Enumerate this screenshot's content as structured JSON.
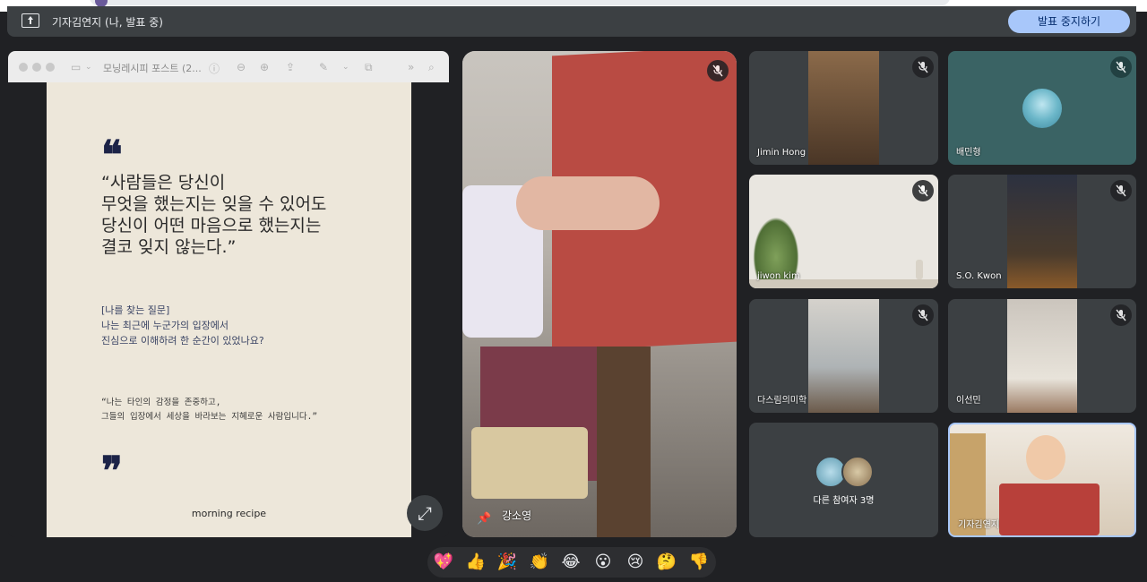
{
  "banner": {
    "presenting_label": "기자김연지 (나, 발표 중)",
    "stop_button": "발표 중지하기"
  },
  "presentation": {
    "viewer_title": "모닝레시피 포스트 (2...",
    "quote_lines": [
      "“사람들은 당신이",
      "무엇을 했는지는 잊을 수 있어도",
      "당신이 어떤 마음으로 했는지는",
      "결코 잊지 않는다.”"
    ],
    "question_lines": [
      "[나를 찾는 질문]",
      "나는 최근에 누군가의 입장에서",
      "진심으로 이해하려 한 순간이 있었나요?"
    ],
    "answer_lines": [
      "“나는 타인의 감정을 존중하고,",
      " 그들의 입장에서 세상을 바라보는 지혜로운 사람입니다.”"
    ],
    "brand": "morning recipe",
    "open_quote": "❝",
    "close_quote": "❞"
  },
  "pinned": {
    "name": "강소영"
  },
  "participants": [
    {
      "name": "Jimin Hong"
    },
    {
      "name": "배민형"
    },
    {
      "name": "jiwon kim"
    },
    {
      "name": "S.O. Kwon"
    },
    {
      "name": "다스림의미학"
    },
    {
      "name": "이선민"
    },
    {
      "name": "다른 참여자 3명"
    },
    {
      "name": "기자김연지"
    }
  ],
  "reactions": [
    "💖",
    "👍",
    "🎉",
    "👏",
    "😂",
    "😮",
    "😢",
    "🤔",
    "👎"
  ],
  "icons": {
    "expand": "⤢",
    "pin": "📌"
  },
  "colors": {
    "accent": "#a8c7fa",
    "tile_bg": "#3c4043",
    "page_bg": "#202124"
  }
}
